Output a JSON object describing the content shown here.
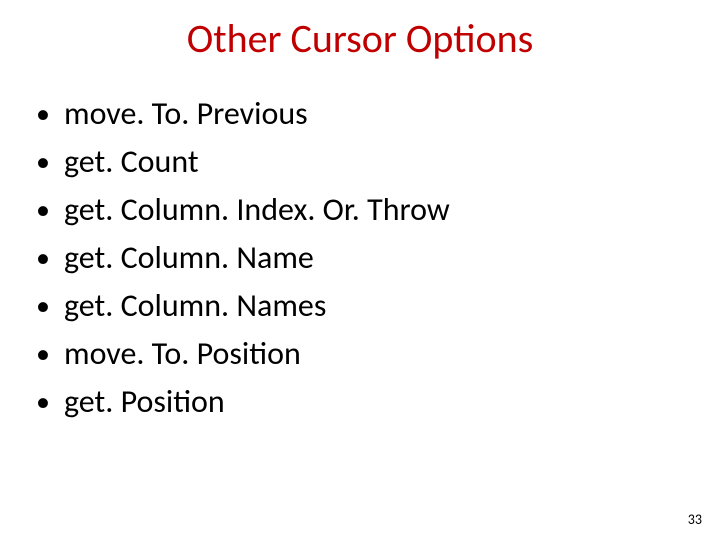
{
  "slide": {
    "title": "Other Cursor Options",
    "bullets": [
      "move. To. Previous",
      "get. Count",
      "get. Column. Index. Or. Throw",
      "get. Column. Name",
      "get. Column. Names",
      "move. To. Position",
      "get. Position"
    ],
    "page_number": "33"
  }
}
